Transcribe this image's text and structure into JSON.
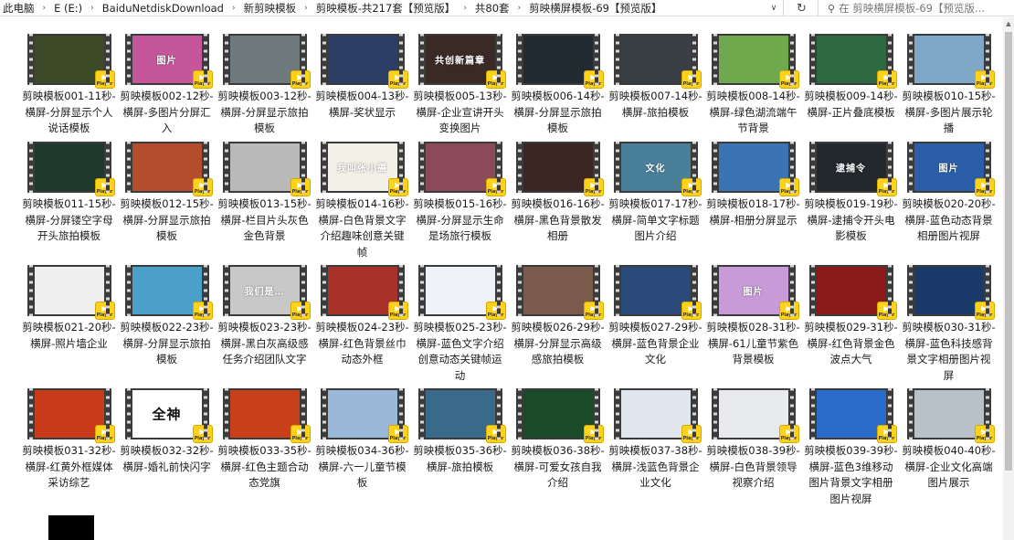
{
  "address": {
    "crumbs": [
      "此电脑",
      "E (E:)",
      "BaiduNetdiskDownload",
      "新剪映模板",
      "剪映模板-共217套【预览版】",
      "共80套",
      "剪映横屏模板-69【预览版】"
    ],
    "separator": "›"
  },
  "search": {
    "placeholder": "在 剪映横屏模板-69【预览版..."
  },
  "badge_label": "Player",
  "icons": {
    "refresh": "refresh-icon",
    "search": "search-icon",
    "dropdown": "chevron-down-icon",
    "play": "play-icon"
  },
  "files": [
    {
      "name": "剪映模板001-11秒-横屏-分屏显示个人说话模板",
      "bg": "#3d4a28"
    },
    {
      "name": "剪映模板002-12秒-横屏-多图片分屏汇入",
      "bg": "#c4579a",
      "text": "图片"
    },
    {
      "name": "剪映模板003-12秒-横屏-分屏显示旅拍模板",
      "bg": "#6f7a7e"
    },
    {
      "name": "剪映模板004-13秒-横屏-奖状显示",
      "bg": "#2c3e63"
    },
    {
      "name": "剪映模板005-13秒-横屏-企业宣讲开头变换图片",
      "bg": "#3a2a26",
      "text": "共创新篇章"
    },
    {
      "name": "剪映模板006-14秒-横屏-分屏显示旅拍模板",
      "bg": "#222b32"
    },
    {
      "name": "剪映模板007-14秒-横屏-旅拍模板",
      "bg": "#3a3f45"
    },
    {
      "name": "剪映模板008-14秒-横屏-绿色湖流端午节背景",
      "bg": "#6fa84d"
    },
    {
      "name": "剪映模板009-14秒-横屏-正片叠底模板",
      "bg": "#2e6a3f"
    },
    {
      "name": "剪映模板010-15秒-横屏-多图片展示轮播",
      "bg": "#7fa8c8"
    },
    {
      "name": "剪映模板011-15秒-横屏-分屏镂空字母开头旅拍模板",
      "bg": "#1f3a2c"
    },
    {
      "name": "剪映模板012-15秒-横屏-分屏显示旅拍模板",
      "bg": "#b44c2e"
    },
    {
      "name": "剪映模板013-15秒-横屏-栏目片头灰色金色背景",
      "bg": "#b9b9b9"
    },
    {
      "name": "剪映模板014-16秒-横屏-白色背景文字介绍趣味创意关键帧",
      "bg": "#f3f0e8",
      "text": "我叫张小摄"
    },
    {
      "name": "剪映模板015-16秒-横屏-分屏显示生命是场旅行模板",
      "bg": "#8a4a5a"
    },
    {
      "name": "剪映模板016-16秒-横屏-黑色背景散发相册",
      "bg": "#3a2622"
    },
    {
      "name": "剪映模板017-17秒-横屏-简单文字标题图片介绍",
      "bg": "#4a7f9a",
      "text": "文化"
    },
    {
      "name": "剪映模板018-17秒-横屏-相册分屏显示",
      "bg": "#3b74b5"
    },
    {
      "name": "剪映模板019-19秒-横屏-逮捕令开头电影模板",
      "bg": "#22282e",
      "text": "逮捕令"
    },
    {
      "name": "剪映模板020-20秒-横屏-蓝色动态背景相册图片视屏",
      "bg": "#2a5fa8",
      "text": "图片"
    },
    {
      "name": "剪映模板021-20秒-横屏-照片墙企业",
      "bg": "#efeff0"
    },
    {
      "name": "剪映模板022-23秒-横屏-分屏显示旅拍模板",
      "bg": "#4aa0c8"
    },
    {
      "name": "剪映模板023-23秒-横屏-黑白灰高级感任务介绍团队文字",
      "bg": "#c8c8c8",
      "text": "我们是…"
    },
    {
      "name": "剪映模板024-23秒-横屏-红色背景丝巾动态外框",
      "bg": "#a8322a"
    },
    {
      "name": "剪映模板025-23秒-横屏-蓝色文字介绍创意动态关键帧运动",
      "bg": "#eef2f6"
    },
    {
      "name": "剪映模板026-29秒-横屏-分屏显示高级感旅拍模板",
      "bg": "#7a5a4a"
    },
    {
      "name": "剪映模板027-29秒-横屏-蓝色背景企业文化",
      "bg": "#2a4a7a"
    },
    {
      "name": "剪映模板028-31秒-横屏-61儿童节紫色背景模板",
      "bg": "#c89ad8",
      "text": "图片"
    },
    {
      "name": "剪映模板029-31秒-横屏-红色背景金色波点大气",
      "bg": "#8a1a1a"
    },
    {
      "name": "剪映模板030-31秒-横屏-蓝色科技感背景文字相册图片视屏",
      "bg": "#1a3a6a"
    },
    {
      "name": "剪映模板031-32秒-横屏-红黄外框媒体采访综艺",
      "bg": "#c83a1a"
    },
    {
      "name": "剪映模板032-32秒-横屏-婚礼前快闪字",
      "bg": "#ffffff",
      "text": "全神",
      "dark": true
    },
    {
      "name": "剪映模板033-35秒-横屏-红色主题合动态党旗",
      "bg": "#c8401a"
    },
    {
      "name": "剪映模板034-36秒-横屏-六一儿童节模板",
      "bg": "#9ab8d8"
    },
    {
      "name": "剪映模板035-36秒-横屏-旅拍模板",
      "bg": "#3a6a8a"
    },
    {
      "name": "剪映模板036-38秒-横屏-可爱女孩自我介绍",
      "bg": "#1a4a2a"
    },
    {
      "name": "剪映模板037-38秒-横屏-浅蓝色背景企业文化",
      "bg": "#dfe6ee"
    },
    {
      "name": "剪映模板038-39秒-横屏-白色背景领导视察介绍",
      "bg": "#e8eaee"
    },
    {
      "name": "剪映模板039-39秒-横屏-蓝色3维移动图片背景文字相册图片视屏",
      "bg": "#2a6ac8"
    },
    {
      "name": "剪映模板040-40秒-横屏-企业文化高端图片展示",
      "bg": "#b8c0c8"
    }
  ]
}
